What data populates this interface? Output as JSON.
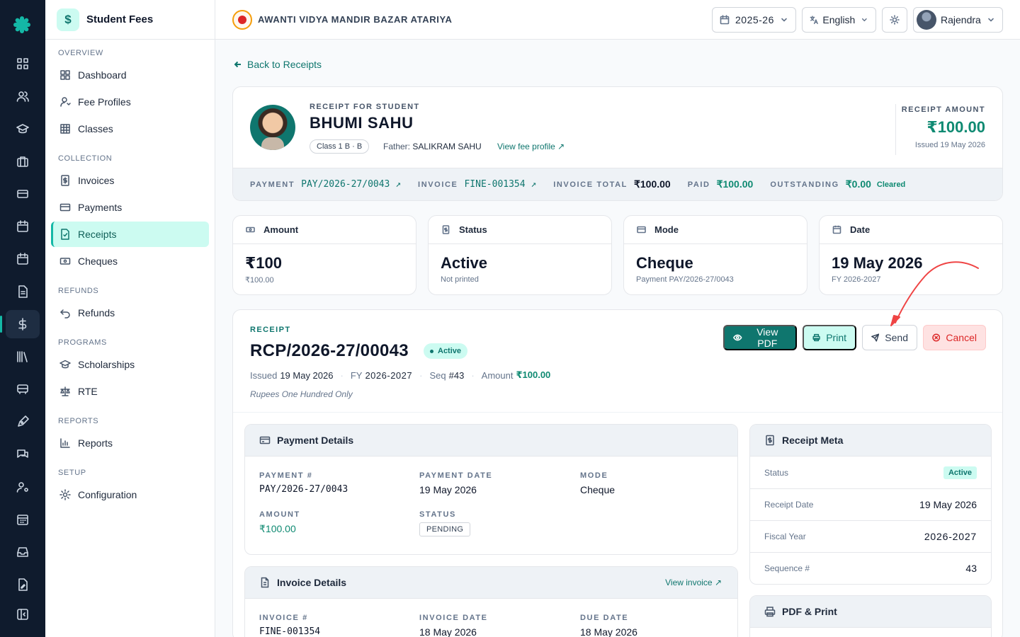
{
  "app": {
    "module_title": "Student Fees",
    "module_icon": "$"
  },
  "topbar": {
    "school_name": "AWANTI VIDYA MANDIR BAZAR ATARIYA",
    "year": "2025-26",
    "language": "English",
    "user": "Rajendra"
  },
  "sidebar": {
    "overview_title": "OVERVIEW",
    "collection_title": "COLLECTION",
    "refunds_title": "REFUNDS",
    "programs_title": "PROGRAMS",
    "reports_title": "REPORTS",
    "setup_title": "SETUP",
    "items": {
      "dashboard": "Dashboard",
      "fee_profiles": "Fee Profiles",
      "classes": "Classes",
      "invoices": "Invoices",
      "payments": "Payments",
      "receipts": "Receipts",
      "cheques": "Cheques",
      "refunds": "Refunds",
      "scholarships": "Scholarships",
      "rte": "RTE",
      "reports": "Reports",
      "configuration": "Configuration"
    },
    "active": "receipts"
  },
  "back_link": "Back to Receipts",
  "student": {
    "label": "RECEIPT FOR STUDENT",
    "name": "BHUMI SAHU",
    "class": "Class 1 B · B",
    "father_label": "Father:",
    "father_name": "SALIKRAM SAHU",
    "fee_profile_link": "View fee profile ↗",
    "receipt_amount_label": "RECEIPT AMOUNT",
    "receipt_amount": "₹100.00",
    "issued": "Issued 19 May 2026"
  },
  "strip": {
    "payment_label": "PAYMENT",
    "payment_value": "PAY/2026-27/0043 ↗",
    "invoice_label": "INVOICE",
    "invoice_value": "FINE-001354 ↗",
    "invoice_total_label": "INVOICE TOTAL",
    "invoice_total_value": "₹100.00",
    "paid_label": "PAID",
    "paid_value": "₹100.00",
    "outstanding_label": "OUTSTANDING",
    "outstanding_value": "₹0.00",
    "cleared": "Cleared"
  },
  "summary": {
    "amount": {
      "title": "Amount",
      "value": "₹100",
      "sub": "₹100.00"
    },
    "status": {
      "title": "Status",
      "value": "Active",
      "sub": "Not printed"
    },
    "mode": {
      "title": "Mode",
      "value": "Cheque",
      "sub": "Payment PAY/2026-27/0043"
    },
    "date": {
      "title": "Date",
      "value": "19 May 2026",
      "sub": "FY 2026-2027"
    }
  },
  "receipt": {
    "label": "RECEIPT",
    "number": "RCP/2026-27/00043",
    "status_badge": "Active",
    "issued_label": "Issued",
    "issued_value": "19 May 2026",
    "fy_label": "FY",
    "fy_value": "2026-2027",
    "seq_label": "Seq",
    "seq_value": "#43",
    "amount_label": "Amount",
    "amount_value": "₹100.00",
    "amount_words": "Rupees One Hundred Only",
    "actions": {
      "view_pdf": "View PDF",
      "print": "Print",
      "send": "Send",
      "cancel": "Cancel"
    }
  },
  "payment_details": {
    "title": "Payment Details",
    "payment_no_label": "PAYMENT #",
    "payment_no": "PAY/2026-27/0043",
    "payment_date_label": "PAYMENT DATE",
    "payment_date": "19 May 2026",
    "mode_label": "MODE",
    "mode": "Cheque",
    "amount_label": "AMOUNT",
    "amount": "₹100.00",
    "status_label": "STATUS",
    "status": "PENDING"
  },
  "invoice_details": {
    "title": "Invoice Details",
    "link": "View invoice ↗",
    "invoice_no_label": "INVOICE #",
    "invoice_no": "FINE-001354",
    "invoice_date_label": "INVOICE DATE",
    "invoice_date": "18 May 2026",
    "due_date_label": "DUE DATE",
    "due_date": "18 May 2026"
  },
  "receipt_meta": {
    "title": "Receipt Meta",
    "status_label": "Status",
    "status": "Active",
    "receipt_date_label": "Receipt Date",
    "receipt_date": "19 May 2026",
    "fiscal_year_label": "Fiscal Year",
    "fiscal_year": "2026-2027",
    "sequence_label": "Sequence #",
    "sequence": "43"
  },
  "pdf_print": {
    "title": "PDF & Print"
  },
  "colors": {
    "accent": "#0f766e",
    "rail": "#0f1b2d",
    "danger": "#dc2626",
    "annotation": "#ef4444"
  }
}
